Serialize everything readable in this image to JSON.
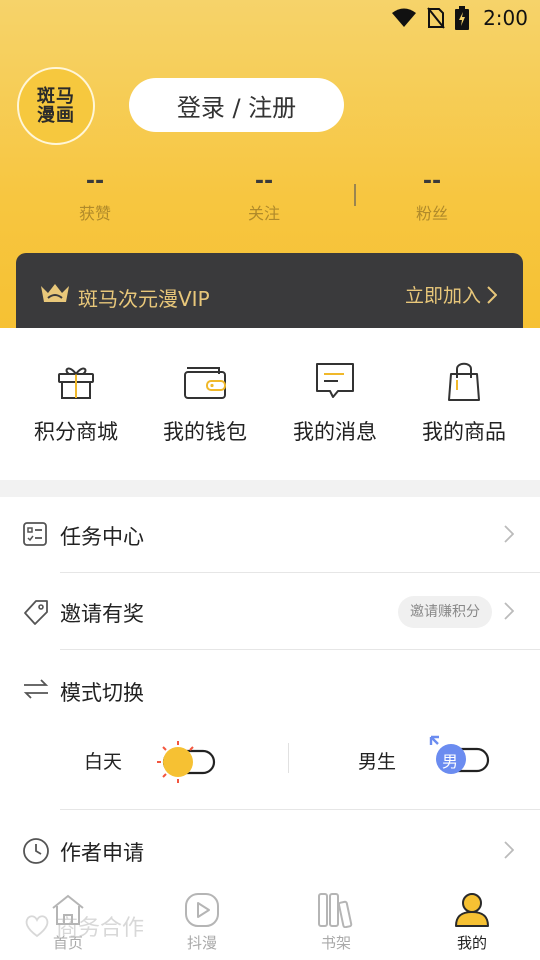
{
  "status_bar": {
    "time": "2:00"
  },
  "profile": {
    "logo_text_line1": "斑马",
    "logo_text_line2": "漫画",
    "login_label": "登录 / 注册"
  },
  "stats": [
    {
      "value": "--",
      "label": "获赞"
    },
    {
      "value": "--",
      "label": "关注"
    },
    {
      "value": "--",
      "label": "粉丝"
    }
  ],
  "vip": {
    "title": "斑马次元漫VIP",
    "join_label": "立即加入"
  },
  "quick_actions": [
    {
      "label": "积分商城",
      "icon": "gift-icon"
    },
    {
      "label": "我的钱包",
      "icon": "wallet-icon"
    },
    {
      "label": "我的消息",
      "icon": "message-icon"
    },
    {
      "label": "我的商品",
      "icon": "bag-icon"
    }
  ],
  "menu": {
    "tasks": {
      "label": "任务中心",
      "icon": "task-list-icon"
    },
    "invite": {
      "label": "邀请有奖",
      "icon": "tag-icon",
      "badge": "邀请赚积分"
    },
    "mode": {
      "label": "模式切换",
      "icon": "switch-arrows-icon",
      "day_label": "白天",
      "gender_label": "男生",
      "gender_badge": "男"
    },
    "author": {
      "label": "作者申请",
      "icon": "clock-icon"
    },
    "business_ghost": "商务合作"
  },
  "bottom_nav": [
    {
      "label": "首页",
      "icon": "home-icon",
      "active": false
    },
    {
      "label": "抖漫",
      "icon": "play-icon",
      "active": false
    },
    {
      "label": "书架",
      "icon": "bookshelf-icon",
      "active": false
    },
    {
      "label": "我的",
      "icon": "user-icon",
      "active": true
    }
  ],
  "colors": {
    "accent": "#f6c133",
    "vip_gold": "#e8c77a",
    "vip_bg": "#3a3a3c",
    "male_blue": "#6b8cf0"
  }
}
